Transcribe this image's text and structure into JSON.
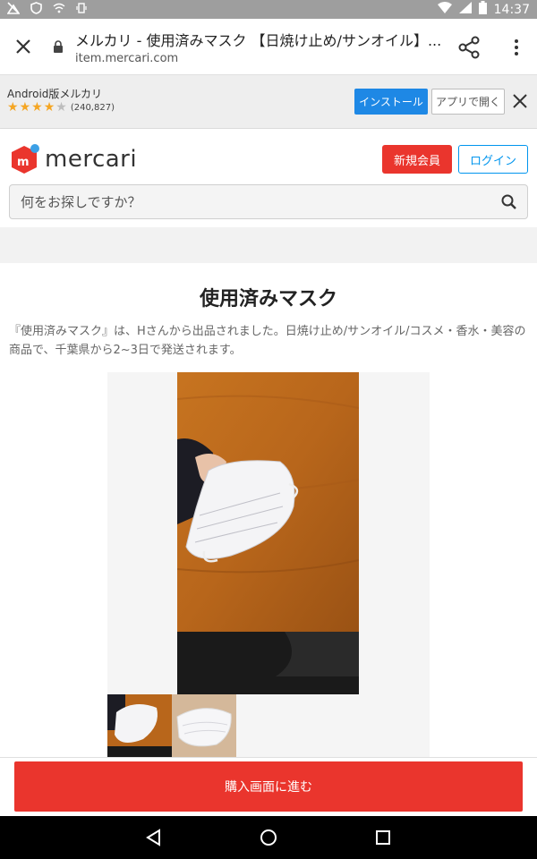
{
  "status_bar": {
    "time": "14:37",
    "icons": [
      "signal-off-icon",
      "shield-icon",
      "wifi-lock-icon",
      "vibrate-icon",
      "wifi-icon",
      "cell-signal-icon",
      "battery-icon"
    ]
  },
  "browser": {
    "title": "メルカリ - 使用済みマスク 【日焼け止め/サンオイル】...",
    "url": "item.mercari.com"
  },
  "app_banner": {
    "app_name": "Android版メルカリ",
    "rating_stars": 4,
    "rating_count": "(240,827)",
    "install_label": "インストール",
    "open_label": "アプリで開く"
  },
  "header": {
    "logo_text": "mercari",
    "register_label": "新規会員",
    "login_label": "ログイン",
    "search_placeholder": "何をお探しですか？"
  },
  "item": {
    "title": "使用済みマスク",
    "description": "『使用済みマスク』は、Hさんから出品されました。日焼け止め/サンオイル/コスメ・香水・美容の商品で、千葉県から2~3日で発送されます。"
  },
  "buy_bar": {
    "buy_label": "購入画面に進む"
  },
  "colors": {
    "brand_red": "#ea352d",
    "brand_blue": "#0095ee",
    "install_blue": "#1e88e5",
    "star": "#f5a623"
  }
}
